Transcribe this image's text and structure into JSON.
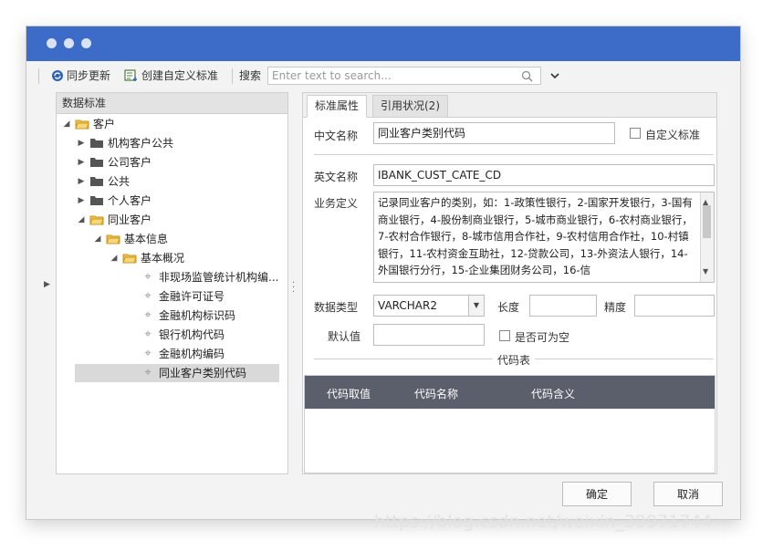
{
  "toolbar": {
    "sync_label": "同步更新",
    "create_label": "创建自定义标准",
    "search_label": "搜索",
    "search_placeholder": "Enter text to search..."
  },
  "left_panel": {
    "header": "数据标准",
    "tree": [
      {
        "label": "客户"
      },
      {
        "label": "机构客户公共"
      },
      {
        "label": "公司客户"
      },
      {
        "label": "公共"
      },
      {
        "label": "个人客户"
      },
      {
        "label": "同业客户"
      },
      {
        "label": "基本信息"
      },
      {
        "label": "基本概况"
      },
      {
        "label": "非现场监管统计机构编..."
      },
      {
        "label": "金融许可证号"
      },
      {
        "label": "金融机构标识码"
      },
      {
        "label": "银行机构代码"
      },
      {
        "label": "金融机构编码"
      },
      {
        "label": "同业客户类别代码"
      }
    ]
  },
  "tabs": [
    {
      "label": "标准属性"
    },
    {
      "label": "引用状况(2)"
    }
  ],
  "form": {
    "cn_name_label": "中文名称",
    "cn_name_value": "同业客户类别代码",
    "custom_std_label": "自定义标准",
    "en_name_label": "英文名称",
    "en_name_value": "IBANK_CUST_CATE_CD",
    "biz_def_label": "业务定义",
    "biz_def_value": "记录同业客户的类别，如：1-政策性银行，2-国家开发银行，3-国有商业银行，4-股份制商业银行，5-城市商业银行，6-农村商业银行，7-农村合作银行，8-城市信用合作社，9-农村信用合作社，10-村镇银行，11-农村资金互助社，12-贷款公司，13-外资法人银行，14-外国银行分行，15-企业集团财务公司，16-信",
    "data_type_label": "数据类型",
    "data_type_value": "VARCHAR2",
    "length_label": "长度",
    "length_value": "",
    "precision_label": "精度",
    "precision_value": "",
    "default_label": "默认值",
    "default_value": "",
    "nullable_label": "是否可为空",
    "code_table_label": "代码表"
  },
  "code_table": {
    "columns": [
      "代码取值",
      "代码名称",
      "代码含义"
    ],
    "rows": []
  },
  "buttons": {
    "ok": "确定",
    "cancel": "取消"
  },
  "watermark": "https://blog.csdn.net/weixin_39971744"
}
